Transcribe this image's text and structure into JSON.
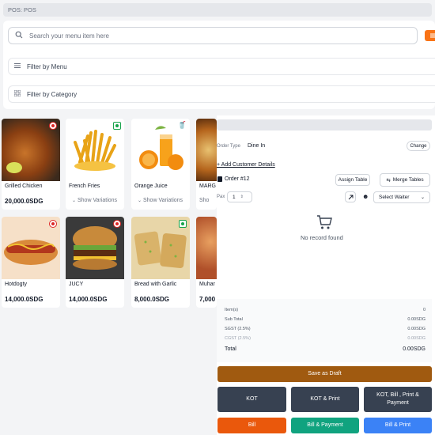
{
  "breadcrumb": "POS:  POS",
  "search": {
    "placeholder": "Search your menu item here"
  },
  "filters": {
    "menu_label": "Filter by Menu",
    "category_label": "Filter by Category"
  },
  "menu_items": [
    {
      "name": "Grilled Chicken",
      "price": "20,000.0SDG",
      "badge": "non-veg"
    },
    {
      "name": "French Fries",
      "variations": "Show Variations",
      "badge": "veg"
    },
    {
      "name": "Orange Juice",
      "variations": "Show Variations",
      "badge": "drink"
    },
    {
      "name": "MARG",
      "variations": "Sho",
      "badge": ""
    },
    {
      "name": "Hotdogty",
      "price": "14,000.0SDG",
      "badge": "non-veg"
    },
    {
      "name": "JUCY",
      "price": "14,000.0SDG",
      "badge": "non-veg"
    },
    {
      "name": "Bread with Garlic",
      "price": "8,000.0SDG",
      "badge": "veg"
    },
    {
      "name": "Muhar",
      "price": "7,000",
      "badge": ""
    }
  ],
  "order": {
    "order_type_label": "Order Type",
    "order_type_value": "Dine In",
    "change_label": "Change",
    "add_customer": "+ Add Customer Details",
    "order_number": "Order #12",
    "assign_table": "Assign Table",
    "merge_tables": "Merge Tables",
    "pax_label": "Pax",
    "pax_value": "1",
    "select_waiter": "Select Waiter",
    "empty_message": "No record found"
  },
  "summary": {
    "items_label": "Item(s)",
    "items_value": "0",
    "subtotal_label": "Sub Total",
    "subtotal_value": "0.00SDG",
    "sgst_label": "SGST (2.5%)",
    "sgst_value": "0.00SDG",
    "cgst_label": "CGST (2.5%)",
    "cgst_value": "0.00SDG",
    "total_label": "Total",
    "total_value": "0.00SDG"
  },
  "actions": {
    "save_draft": "Save as Draft",
    "kot": "KOT",
    "kot_print": "KOT & Print",
    "kot_bill_print_payment": "KOT, Bill , Print & Payment",
    "bill": "Bill",
    "bill_payment": "Bill & Payment",
    "bill_print": "Bill & Print"
  },
  "colors": {
    "accent": "#f97316",
    "draft": "#a05a10",
    "dark_btn": "#374151",
    "bill": "#ea580c",
    "bill_payment": "#10a37f",
    "bill_print": "#3b82f6"
  }
}
